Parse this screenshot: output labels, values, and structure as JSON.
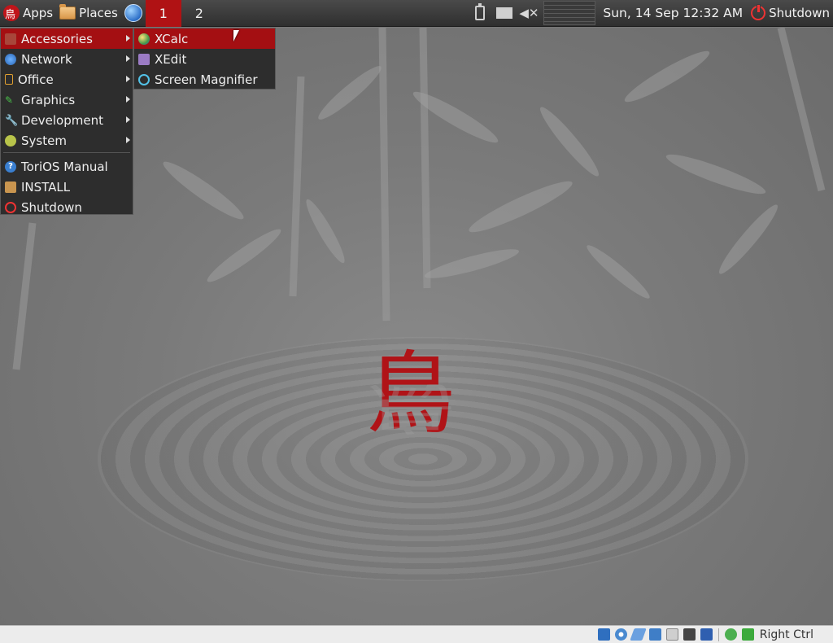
{
  "panel": {
    "apps_label": "Apps",
    "apps_logo_glyph": "鳥",
    "places_label": "Places",
    "workspaces": [
      "1",
      "2"
    ],
    "active_workspace": "1",
    "clock": "Sun, 14 Sep 12:32 AM",
    "shutdown_label": "Shutdown"
  },
  "main_menu": {
    "items": [
      {
        "label": "Accessories",
        "icon": "accessories-icon"
      },
      {
        "label": "Network",
        "icon": "network-icon"
      },
      {
        "label": "Office",
        "icon": "office-icon"
      },
      {
        "label": "Graphics",
        "icon": "graphics-icon"
      },
      {
        "label": "Development",
        "icon": "development-icon"
      },
      {
        "label": "System",
        "icon": "system-icon"
      }
    ],
    "extra_items": [
      {
        "label": "ToriOS Manual",
        "icon": "help-icon"
      },
      {
        "label": "INSTALL",
        "icon": "install-icon"
      },
      {
        "label": "Shutdown",
        "icon": "power-icon"
      }
    ]
  },
  "submenu": {
    "items": [
      {
        "label": "XCalc",
        "icon": "calculator-icon"
      },
      {
        "label": "XEdit",
        "icon": "text-editor-icon"
      },
      {
        "label": "Screen Magnifier",
        "icon": "magnifier-icon"
      }
    ]
  },
  "desktop": {
    "wallpaper_glyph": "鳥"
  },
  "statusbar": {
    "host_key": "Right Ctrl"
  },
  "colors": {
    "accent": "#a40f12",
    "panel_bg": "#3a3a3a",
    "menu_bg": "#2d2d2d"
  }
}
